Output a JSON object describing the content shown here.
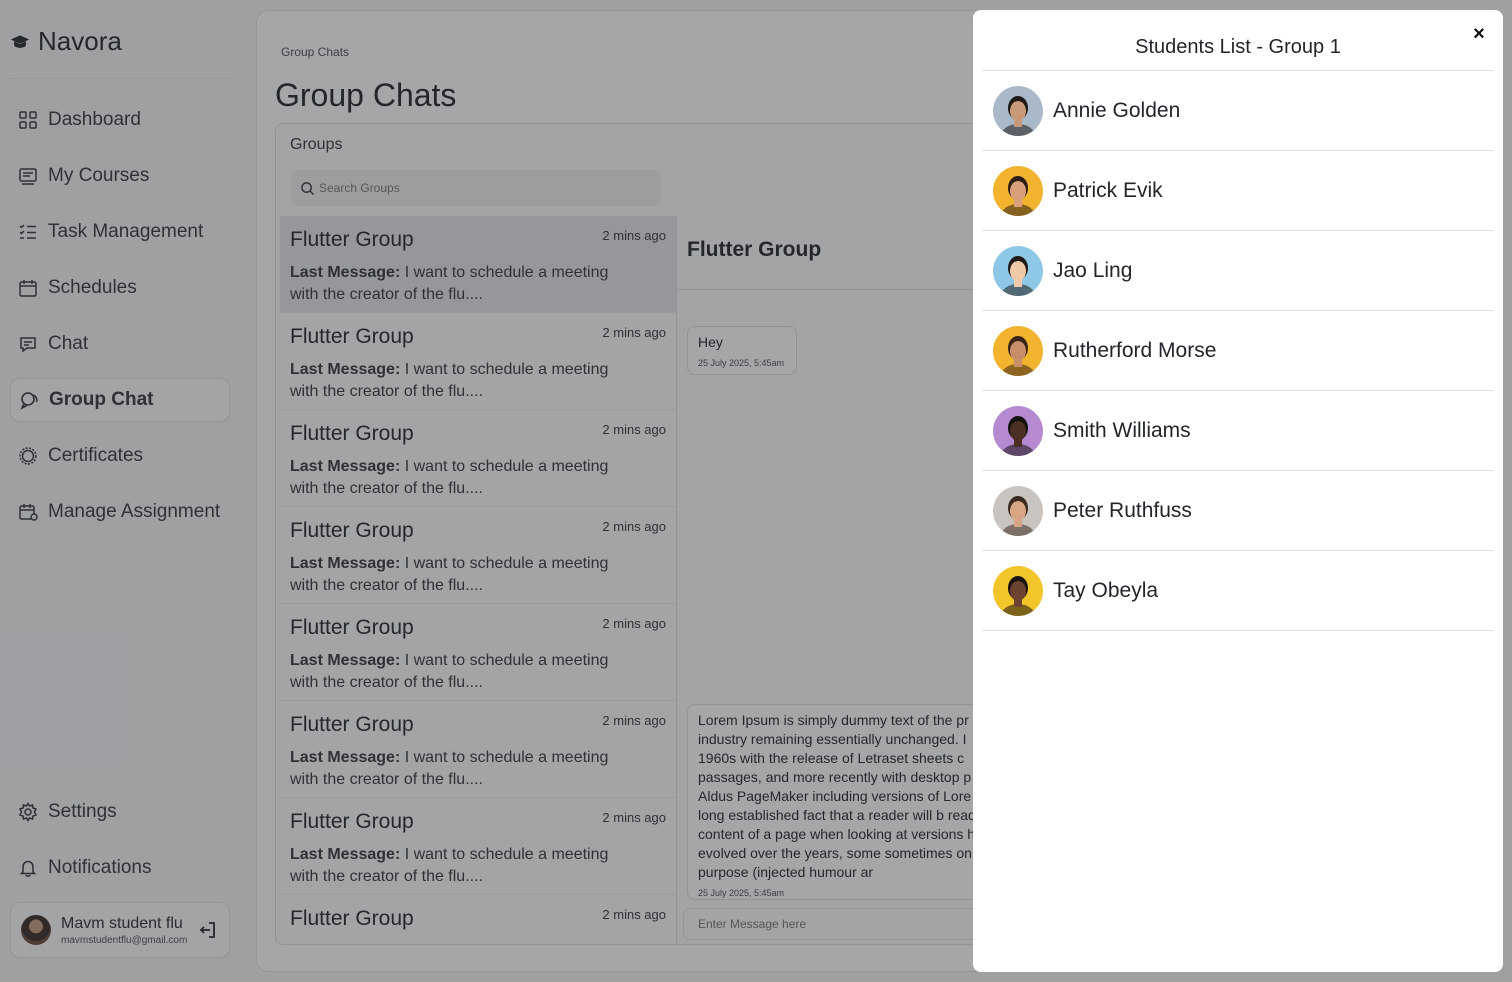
{
  "app": {
    "brand": "Navora"
  },
  "sidebar": {
    "items": [
      {
        "label": "Dashboard",
        "icon": "dashboard-icon"
      },
      {
        "label": "My Courses",
        "icon": "courses-icon"
      },
      {
        "label": "Task Management",
        "icon": "tasks-icon"
      },
      {
        "label": "Schedules",
        "icon": "calendar-icon"
      },
      {
        "label": "Chat",
        "icon": "chat-icon"
      },
      {
        "label": "Group Chat",
        "icon": "group-chat-icon",
        "active": true
      },
      {
        "label": "Certificates",
        "icon": "certificate-icon"
      },
      {
        "label": "Manage Assignment",
        "icon": "assignment-icon"
      }
    ],
    "bottom_items": [
      {
        "label": "Settings",
        "icon": "gear-icon"
      },
      {
        "label": "Notifications",
        "icon": "bell-icon"
      }
    ],
    "user": {
      "name": "Mavm student flu",
      "email": "mavmstudentflu@gmail.com"
    }
  },
  "main": {
    "breadcrumb": "Group Chats",
    "title": "Group Chats",
    "groups_label": "Groups",
    "search": {
      "placeholder": "Search Groups"
    },
    "groups": [
      {
        "name": "Flutter Group",
        "time": "2 mins ago",
        "last_label": "Last Message:",
        "last_message": "I want to schedule a meeting with the creator of the flu...."
      },
      {
        "name": "Flutter Group",
        "time": "2 mins ago",
        "last_label": "Last Message:",
        "last_message": "I want to schedule a meeting with the creator of the flu...."
      },
      {
        "name": "Flutter Group",
        "time": "2 mins ago",
        "last_label": "Last Message:",
        "last_message": "I want to schedule a meeting with the creator of the flu...."
      },
      {
        "name": "Flutter Group",
        "time": "2 mins ago",
        "last_label": "Last Message:",
        "last_message": "I want to schedule a meeting with the creator of the flu...."
      },
      {
        "name": "Flutter Group",
        "time": "2 mins ago",
        "last_label": "Last Message:",
        "last_message": "I want to schedule a meeting with the creator of the flu...."
      },
      {
        "name": "Flutter Group",
        "time": "2 mins ago",
        "last_label": "Last Message:",
        "last_message": "I want to schedule a meeting with the creator of the flu...."
      },
      {
        "name": "Flutter Group",
        "time": "2 mins ago",
        "last_label": "Last Message:",
        "last_message": "I want to schedule a meeting with the creator of the flu...."
      },
      {
        "name": "Flutter Group",
        "time": "2 mins ago"
      }
    ],
    "chat": {
      "title": "Flutter Group",
      "messages": [
        {
          "text": "Hey",
          "time": "25 July 2025, 5:45am"
        },
        {
          "text": "Lorem Ipsum is simply dummy text of the pr industry remaining essentially unchanged. I 1960s with the release of Letraset sheets c passages, and more recently with desktop p Aldus PageMaker including versions of Lore is a long established fact that a reader will b readable content of a page when looking at versions have evolved over the years, some sometimes on purpose (injected humour ar",
          "time": "25 July 2025, 5:45am"
        }
      ],
      "input_placeholder": "Enter Message here"
    }
  },
  "modal": {
    "title": "Students List - Group 1",
    "close_label": "×",
    "students": [
      {
        "name": "Annie Golden",
        "avatar_bg": "#a9b9c9",
        "skin": "#c89a7a",
        "hair": "#1e1a18"
      },
      {
        "name": "Patrick Evik",
        "avatar_bg": "#f2b32e",
        "skin": "#d8a07a",
        "hair": "#2b1d14"
      },
      {
        "name": "Jao Ling",
        "avatar_bg": "#8fc8e6",
        "skin": "#f0c9a8",
        "hair": "#1f1a18"
      },
      {
        "name": "Rutherford Morse",
        "avatar_bg": "#f2b32e",
        "skin": "#c88e6a",
        "hair": "#3a2418"
      },
      {
        "name": "Smith Williams",
        "avatar_bg": "#b68ad0",
        "skin": "#4a2f22",
        "hair": "#141010"
      },
      {
        "name": "Peter Ruthfuss",
        "avatar_bg": "#c9c4bf",
        "skin": "#d8a685",
        "hair": "#3a2a20"
      },
      {
        "name": "Tay Obeyla",
        "avatar_bg": "#f2c62a",
        "skin": "#6b4330",
        "hair": "#1a1210"
      }
    ]
  }
}
